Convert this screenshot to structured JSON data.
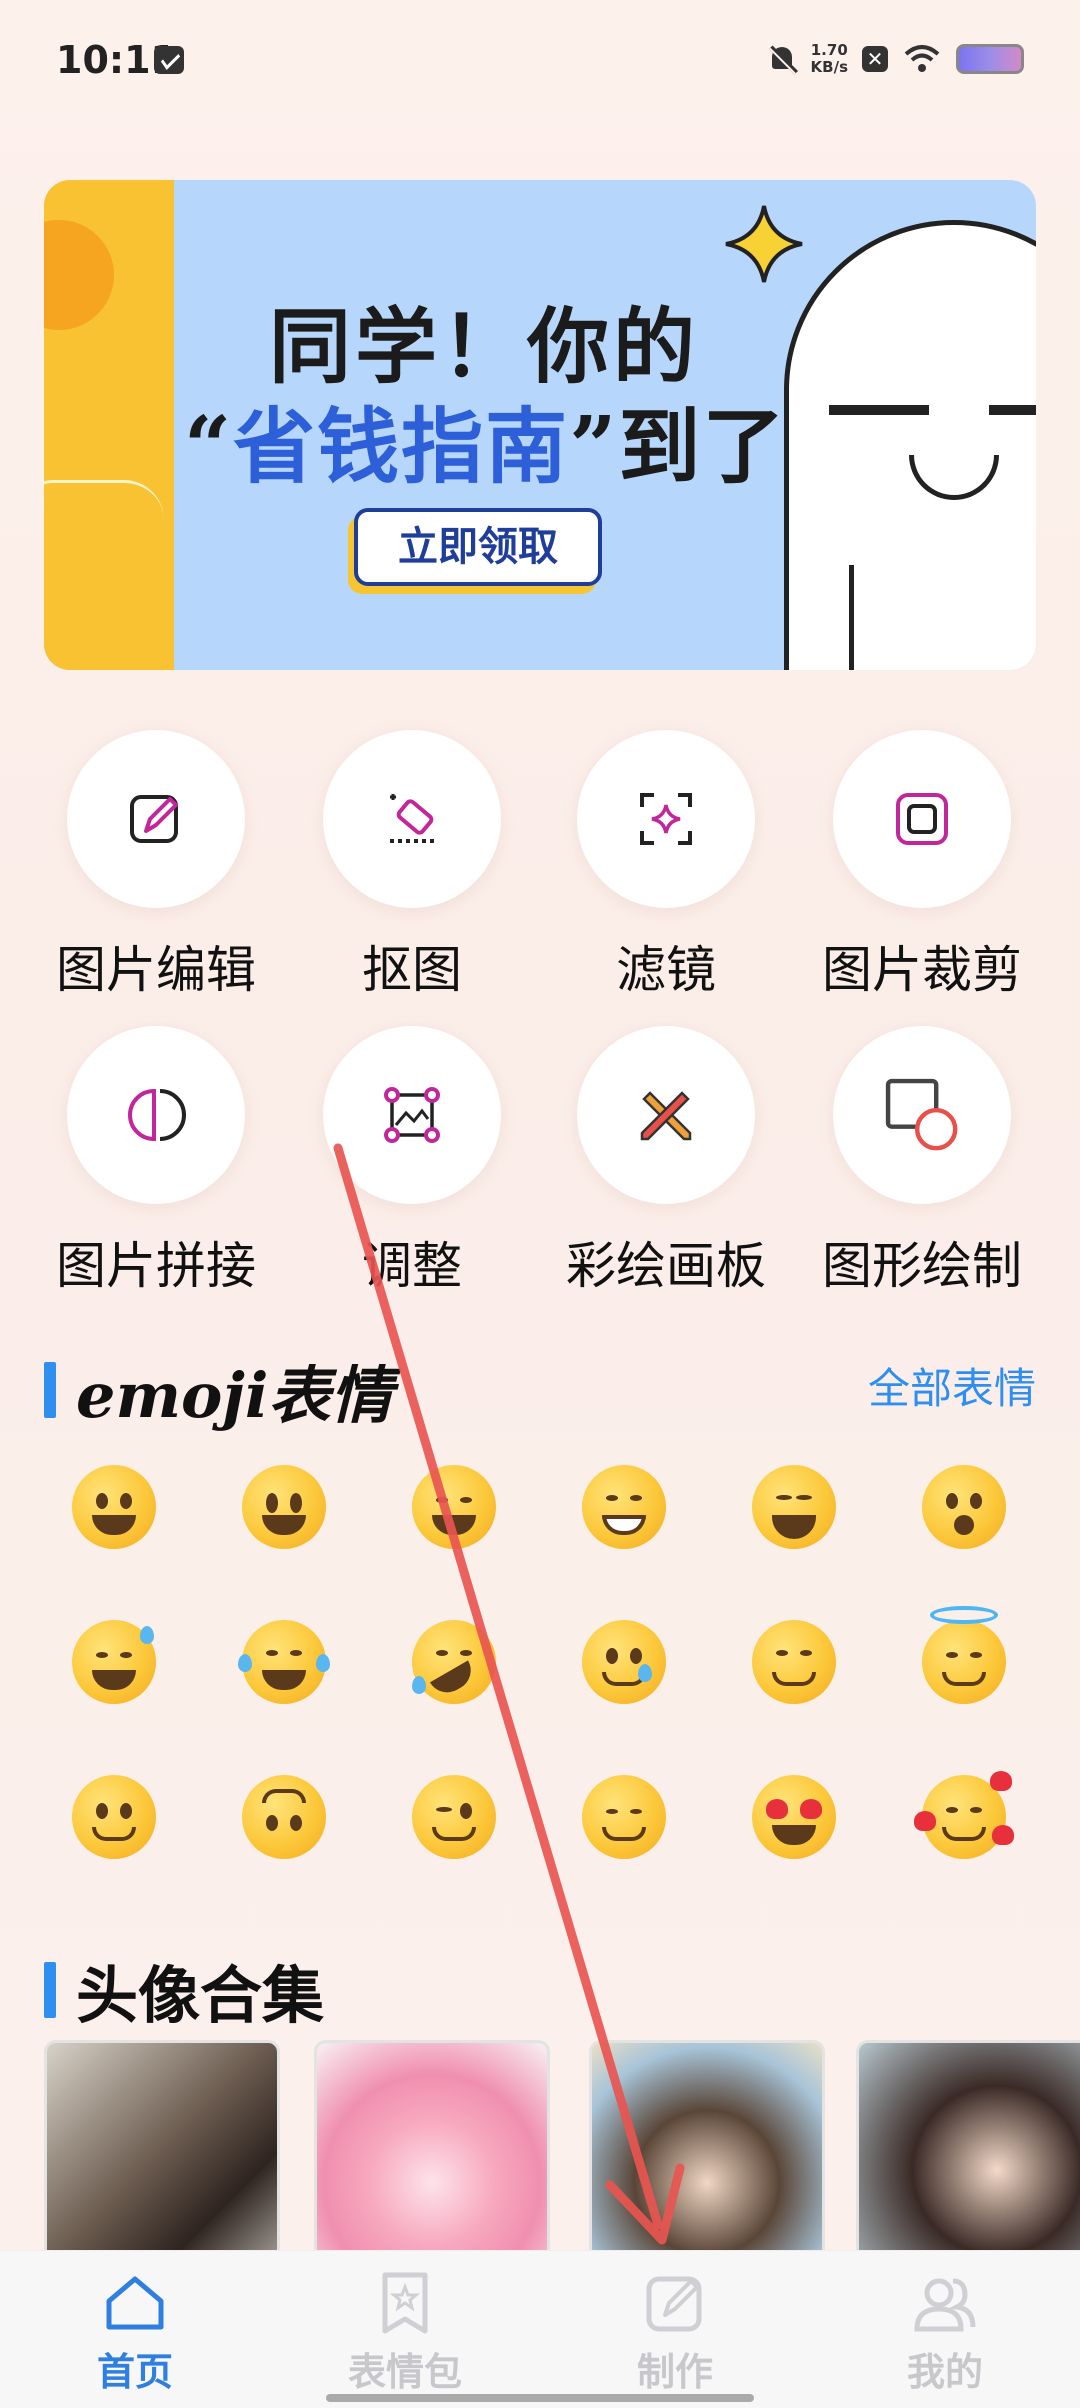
{
  "status_bar": {
    "time": "10:11",
    "net_speed_value": "1.70",
    "net_speed_unit": "KB/s"
  },
  "banner": {
    "line1": "同学！你的",
    "line2_quote_open": "“",
    "line2_highlight": "省钱指南",
    "line2_quote_close": "”",
    "line2_tail": "到了",
    "button_label": "立即领取"
  },
  "tools": [
    {
      "label": "图片编辑",
      "icon": "edit-image-icon"
    },
    {
      "label": "抠图",
      "icon": "eraser-icon"
    },
    {
      "label": "滤镜",
      "icon": "sparkle-filter-icon"
    },
    {
      "label": "图片裁剪",
      "icon": "crop-icon"
    },
    {
      "label": "图片拼接",
      "icon": "split-circle-icon"
    },
    {
      "label": "调整",
      "icon": "transform-icon"
    },
    {
      "label": "彩绘画板",
      "icon": "pencils-cross-icon"
    },
    {
      "label": "图形绘制",
      "icon": "shapes-icon"
    }
  ],
  "emoji_section": {
    "title": "emoji表情",
    "more_link": "全部表情"
  },
  "avatar_section": {
    "title": "头像合集"
  },
  "bottom_nav": [
    {
      "label": "首页",
      "icon": "home-icon",
      "active": true
    },
    {
      "label": "表情包",
      "icon": "sticker-star-icon",
      "active": false
    },
    {
      "label": "制作",
      "icon": "compose-icon",
      "active": false
    },
    {
      "label": "我的",
      "icon": "profile-icon",
      "active": false
    }
  ],
  "colors": {
    "accent": "#2f8ff0",
    "nav_active": "#2f7fe0",
    "tool_icon": "#c2269b",
    "annotation_arrow": "#e85550"
  }
}
